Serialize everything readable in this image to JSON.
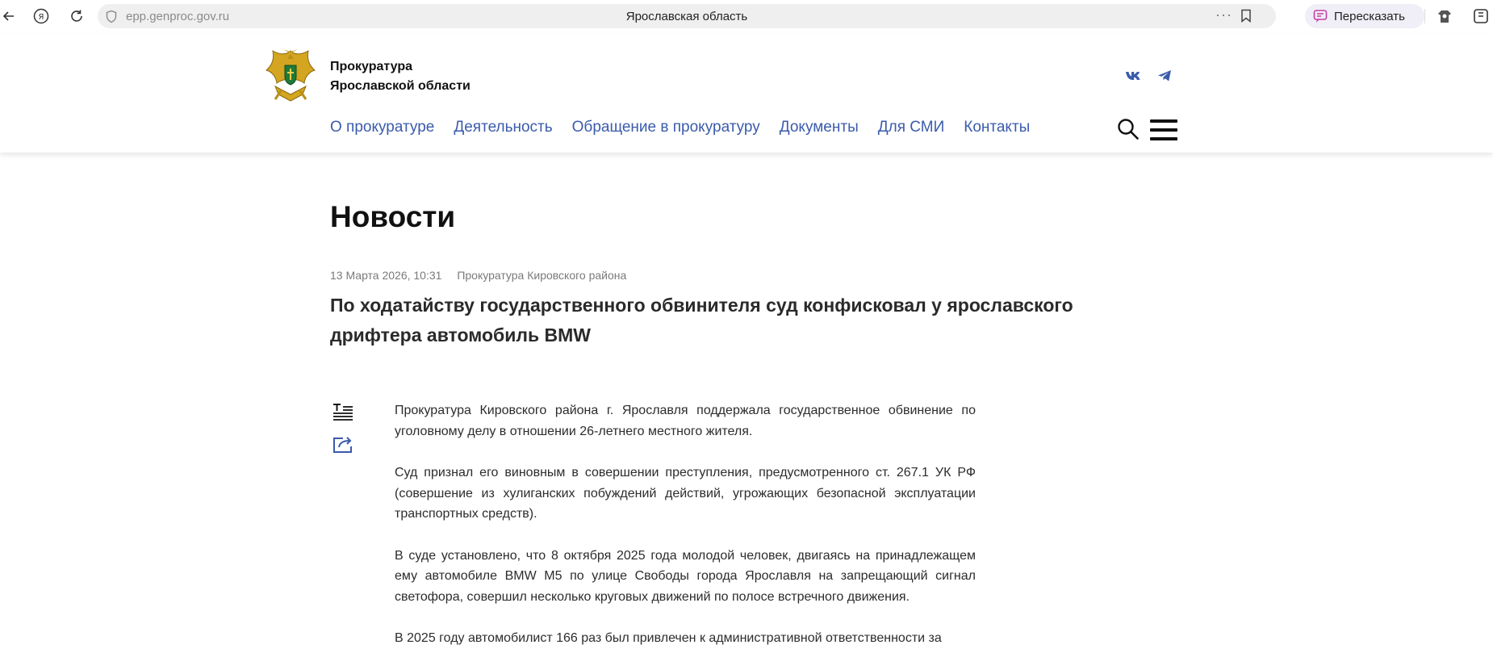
{
  "browser": {
    "url": "epp.genproc.gov.ru",
    "page_title": "Ярославская область",
    "retell_label": "Пересказать"
  },
  "site": {
    "org_line1": "Прокуратура",
    "org_line2": "Ярославской области",
    "nav": [
      {
        "label": "О прокуратуре"
      },
      {
        "label": "Деятельность"
      },
      {
        "label": "Обращение в прокуратуру"
      },
      {
        "label": "Документы"
      },
      {
        "label": "Для СМИ"
      },
      {
        "label": "Контакты"
      }
    ],
    "social": [
      "vk-icon",
      "telegram-icon"
    ],
    "accent_color": "#3b5bab"
  },
  "page": {
    "heading": "Новости",
    "date": "13 Марта 2026, 10:31",
    "source": "Прокуратура Кировского района",
    "headline": "По ходатайству государственного обвинителя суд конфисковал у ярославского дрифтера автомобиль BMW",
    "paragraphs": [
      "Прокуратура Кировского района г. Ярославля поддержала государственное обвинение по уголовному делу в отношении 26-летнего местного жителя.",
      "Суд признал его виновным в совершении преступления, предусмотренного ст. 267.1 УК РФ (совершение из хулиганских побуждений действий, угрожающих безопасной эксплуатации транспортных средств).",
      "В суде установлено, что 8 октября 2025 года молодой человек, двигаясь на принадлежащем ему автомобиле BMW M5 по улице Свободы города Ярославля на запрещающий сигнал светофора, совершил несколько круговых движений по полосе встречного движения.",
      "В 2025 году автомобилист 166 раз был привлечен к административной ответственности за"
    ]
  }
}
